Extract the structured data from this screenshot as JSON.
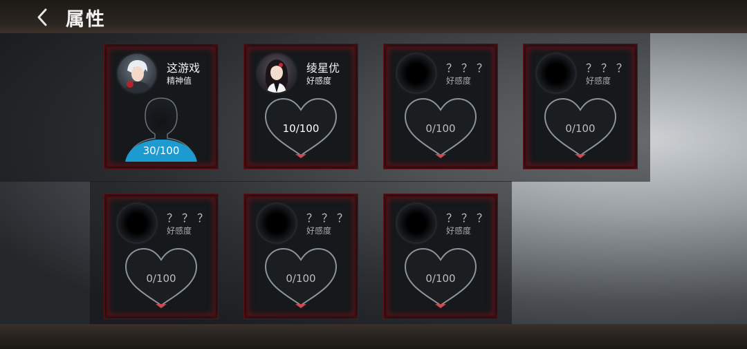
{
  "header": {
    "title": "属性",
    "back_icon": "chevron-left-icon"
  },
  "cards": [
    {
      "name": "这游戏",
      "subtitle": "精神值",
      "value": "30/100",
      "progress": 0.3,
      "type": "mind",
      "fill_color": "#1d9ad0"
    },
    {
      "name": "绫星优",
      "subtitle": "好感度",
      "value": "10/100",
      "progress": 0.1,
      "type": "heart"
    },
    {
      "name": "？？？",
      "subtitle": "好感度",
      "value": "0/100",
      "progress": 0,
      "type": "heart"
    },
    {
      "name": "？？？",
      "subtitle": "好感度",
      "value": "0/100",
      "progress": 0,
      "type": "heart"
    },
    {
      "name": "？？？",
      "subtitle": "好感度",
      "value": "0/100",
      "progress": 0,
      "type": "heart"
    },
    {
      "name": "？？？",
      "subtitle": "好感度",
      "value": "0/100",
      "progress": 0,
      "type": "heart"
    },
    {
      "name": "？？？",
      "subtitle": "好感度",
      "value": "0/100",
      "progress": 0,
      "type": "heart"
    }
  ]
}
